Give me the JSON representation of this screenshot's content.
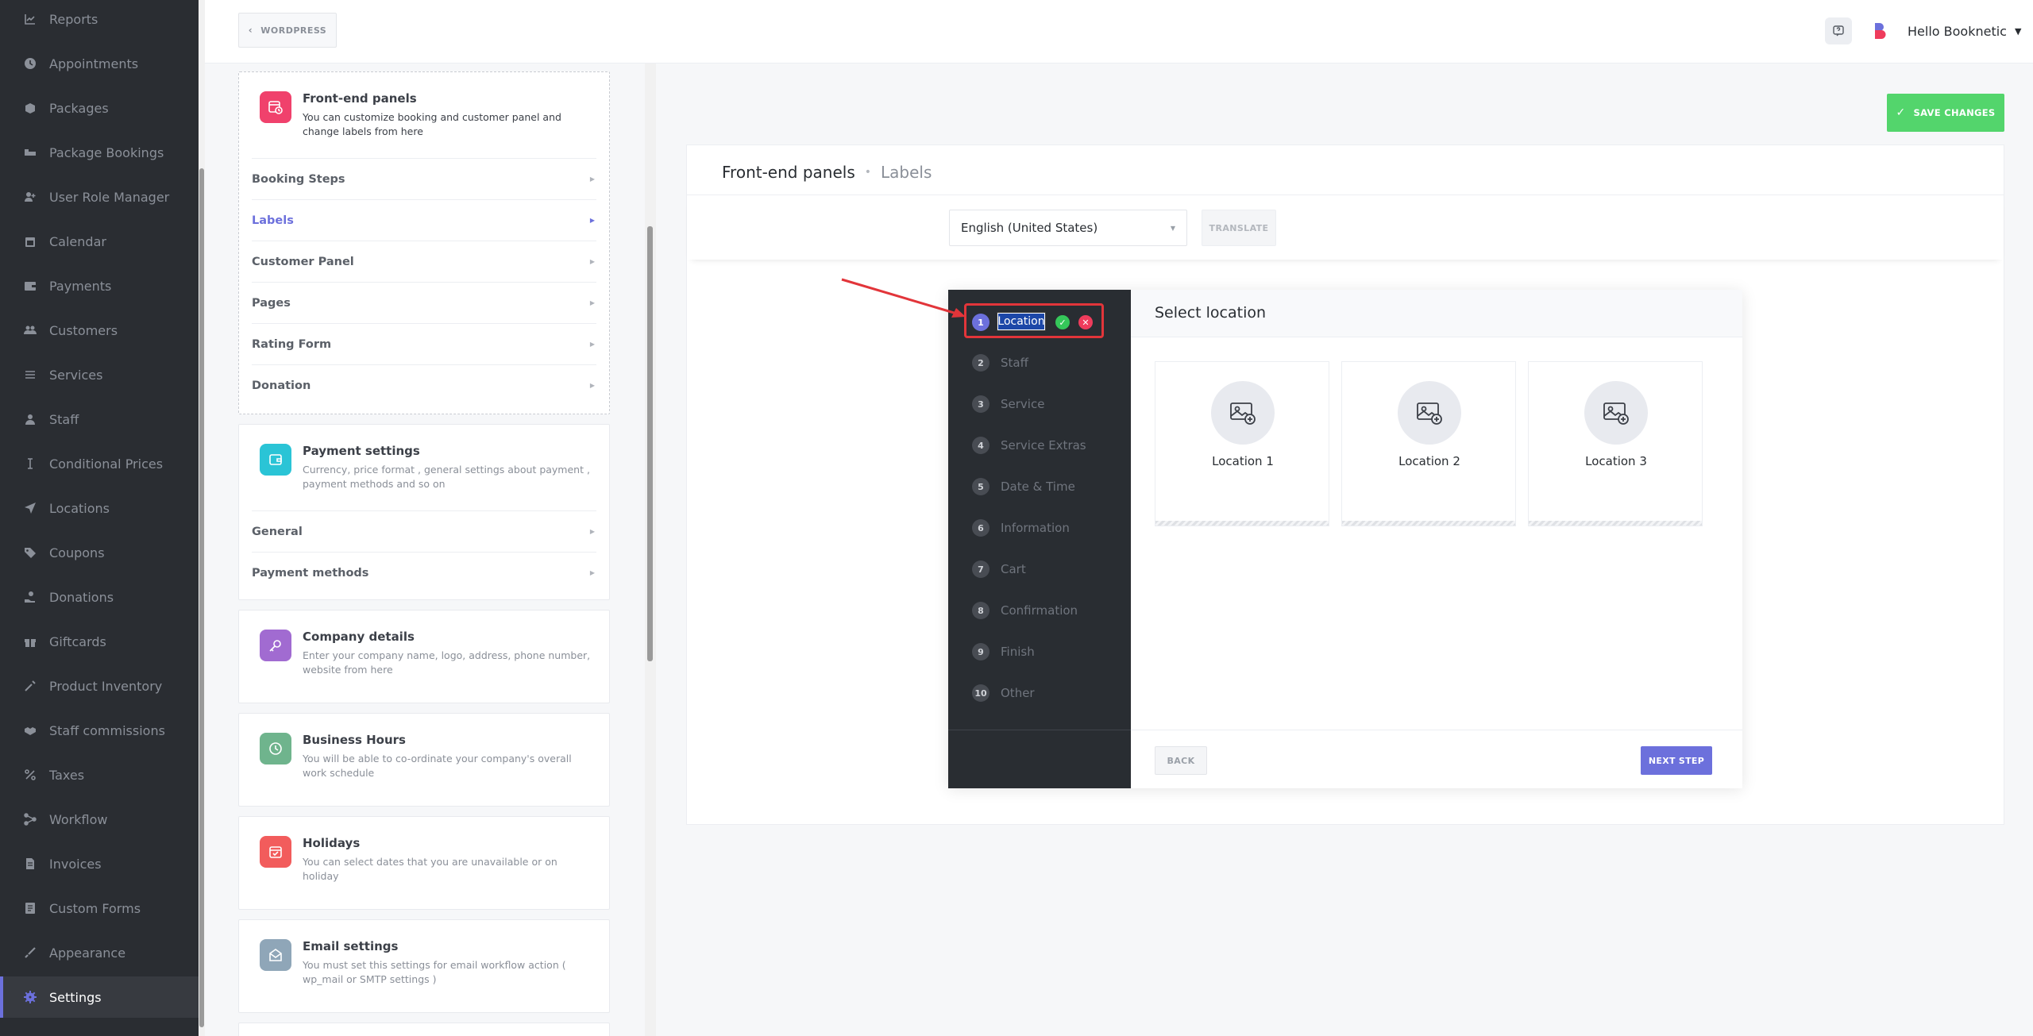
{
  "sidebar": {
    "items": [
      {
        "label": "Reports",
        "icon": "chart-icon"
      },
      {
        "label": "Appointments",
        "icon": "clock-icon"
      },
      {
        "label": "Packages",
        "icon": "box-icon"
      },
      {
        "label": "Package Bookings",
        "icon": "bed-icon"
      },
      {
        "label": "User Role Manager",
        "icon": "user-plus-icon"
      },
      {
        "label": "Calendar",
        "icon": "calendar-icon"
      },
      {
        "label": "Payments",
        "icon": "wallet-icon"
      },
      {
        "label": "Customers",
        "icon": "users-icon"
      },
      {
        "label": "Services",
        "icon": "list-icon"
      },
      {
        "label": "Staff",
        "icon": "user-icon"
      },
      {
        "label": "Conditional Prices",
        "icon": "text-cursor-icon"
      },
      {
        "label": "Locations",
        "icon": "location-arrow-icon"
      },
      {
        "label": "Coupons",
        "icon": "tag-icon"
      },
      {
        "label": "Donations",
        "icon": "donation-icon"
      },
      {
        "label": "Giftcards",
        "icon": "gift-icon"
      },
      {
        "label": "Product Inventory",
        "icon": "tools-icon"
      },
      {
        "label": "Staff commissions",
        "icon": "handshake-icon"
      },
      {
        "label": "Taxes",
        "icon": "percent-icon"
      },
      {
        "label": "Workflow",
        "icon": "workflow-icon"
      },
      {
        "label": "Invoices",
        "icon": "invoice-icon"
      },
      {
        "label": "Custom Forms",
        "icon": "form-icon"
      },
      {
        "label": "Appearance",
        "icon": "brush-icon"
      },
      {
        "label": "Settings",
        "icon": "gear-icon"
      }
    ],
    "active": "Settings"
  },
  "topbar": {
    "back_label": "WORDPRESS",
    "user_label": "Hello Booknetic"
  },
  "settings": {
    "frontend": {
      "title": "Front-end panels",
      "desc": "You can customize booking and customer panel and change labels from here",
      "items": [
        "Booking Steps",
        "Labels",
        "Customer Panel",
        "Pages",
        "Rating Form",
        "Donation"
      ]
    },
    "payment": {
      "title": "Payment settings",
      "desc": "Currency, price format , general settings about payment , payment methods and so on",
      "items": [
        "General",
        "Payment methods"
      ]
    },
    "company": {
      "title": "Company details",
      "desc": "Enter your company name, logo, address, phone number, website from here"
    },
    "hours": {
      "title": "Business Hours",
      "desc": "You will be able to co-ordinate your company's overall work schedule"
    },
    "holidays": {
      "title": "Holidays",
      "desc": "You can select dates that you are unavailable or on holiday"
    },
    "email": {
      "title": "Email settings",
      "desc": "You must set this settings for email workflow action ( wp_mail or SMTP settings )"
    }
  },
  "main": {
    "save_label": "SAVE CHANGES",
    "crumb_1": "Front-end panels",
    "crumb_2": "Labels",
    "language": "English (United States)",
    "translate_label": "TRANSLATE"
  },
  "booking_panel": {
    "steps": [
      {
        "num": "1",
        "label": "Location"
      },
      {
        "num": "2",
        "label": "Staff"
      },
      {
        "num": "3",
        "label": "Service"
      },
      {
        "num": "4",
        "label": "Service Extras"
      },
      {
        "num": "5",
        "label": "Date & Time"
      },
      {
        "num": "6",
        "label": "Information"
      },
      {
        "num": "7",
        "label": "Cart"
      },
      {
        "num": "8",
        "label": "Confirmation"
      },
      {
        "num": "9",
        "label": "Finish"
      },
      {
        "num": "10",
        "label": "Other"
      }
    ],
    "title": "Select location",
    "locations": [
      "Location 1",
      "Location 2",
      "Location 3"
    ],
    "back_label": "BACK",
    "next_label": "NEXT STEP"
  },
  "colors": {
    "accent": "#6c70dc",
    "save_green": "#53d56c",
    "sidebar_bg": "#2a2d32",
    "highlight_red": "#e2353a"
  }
}
